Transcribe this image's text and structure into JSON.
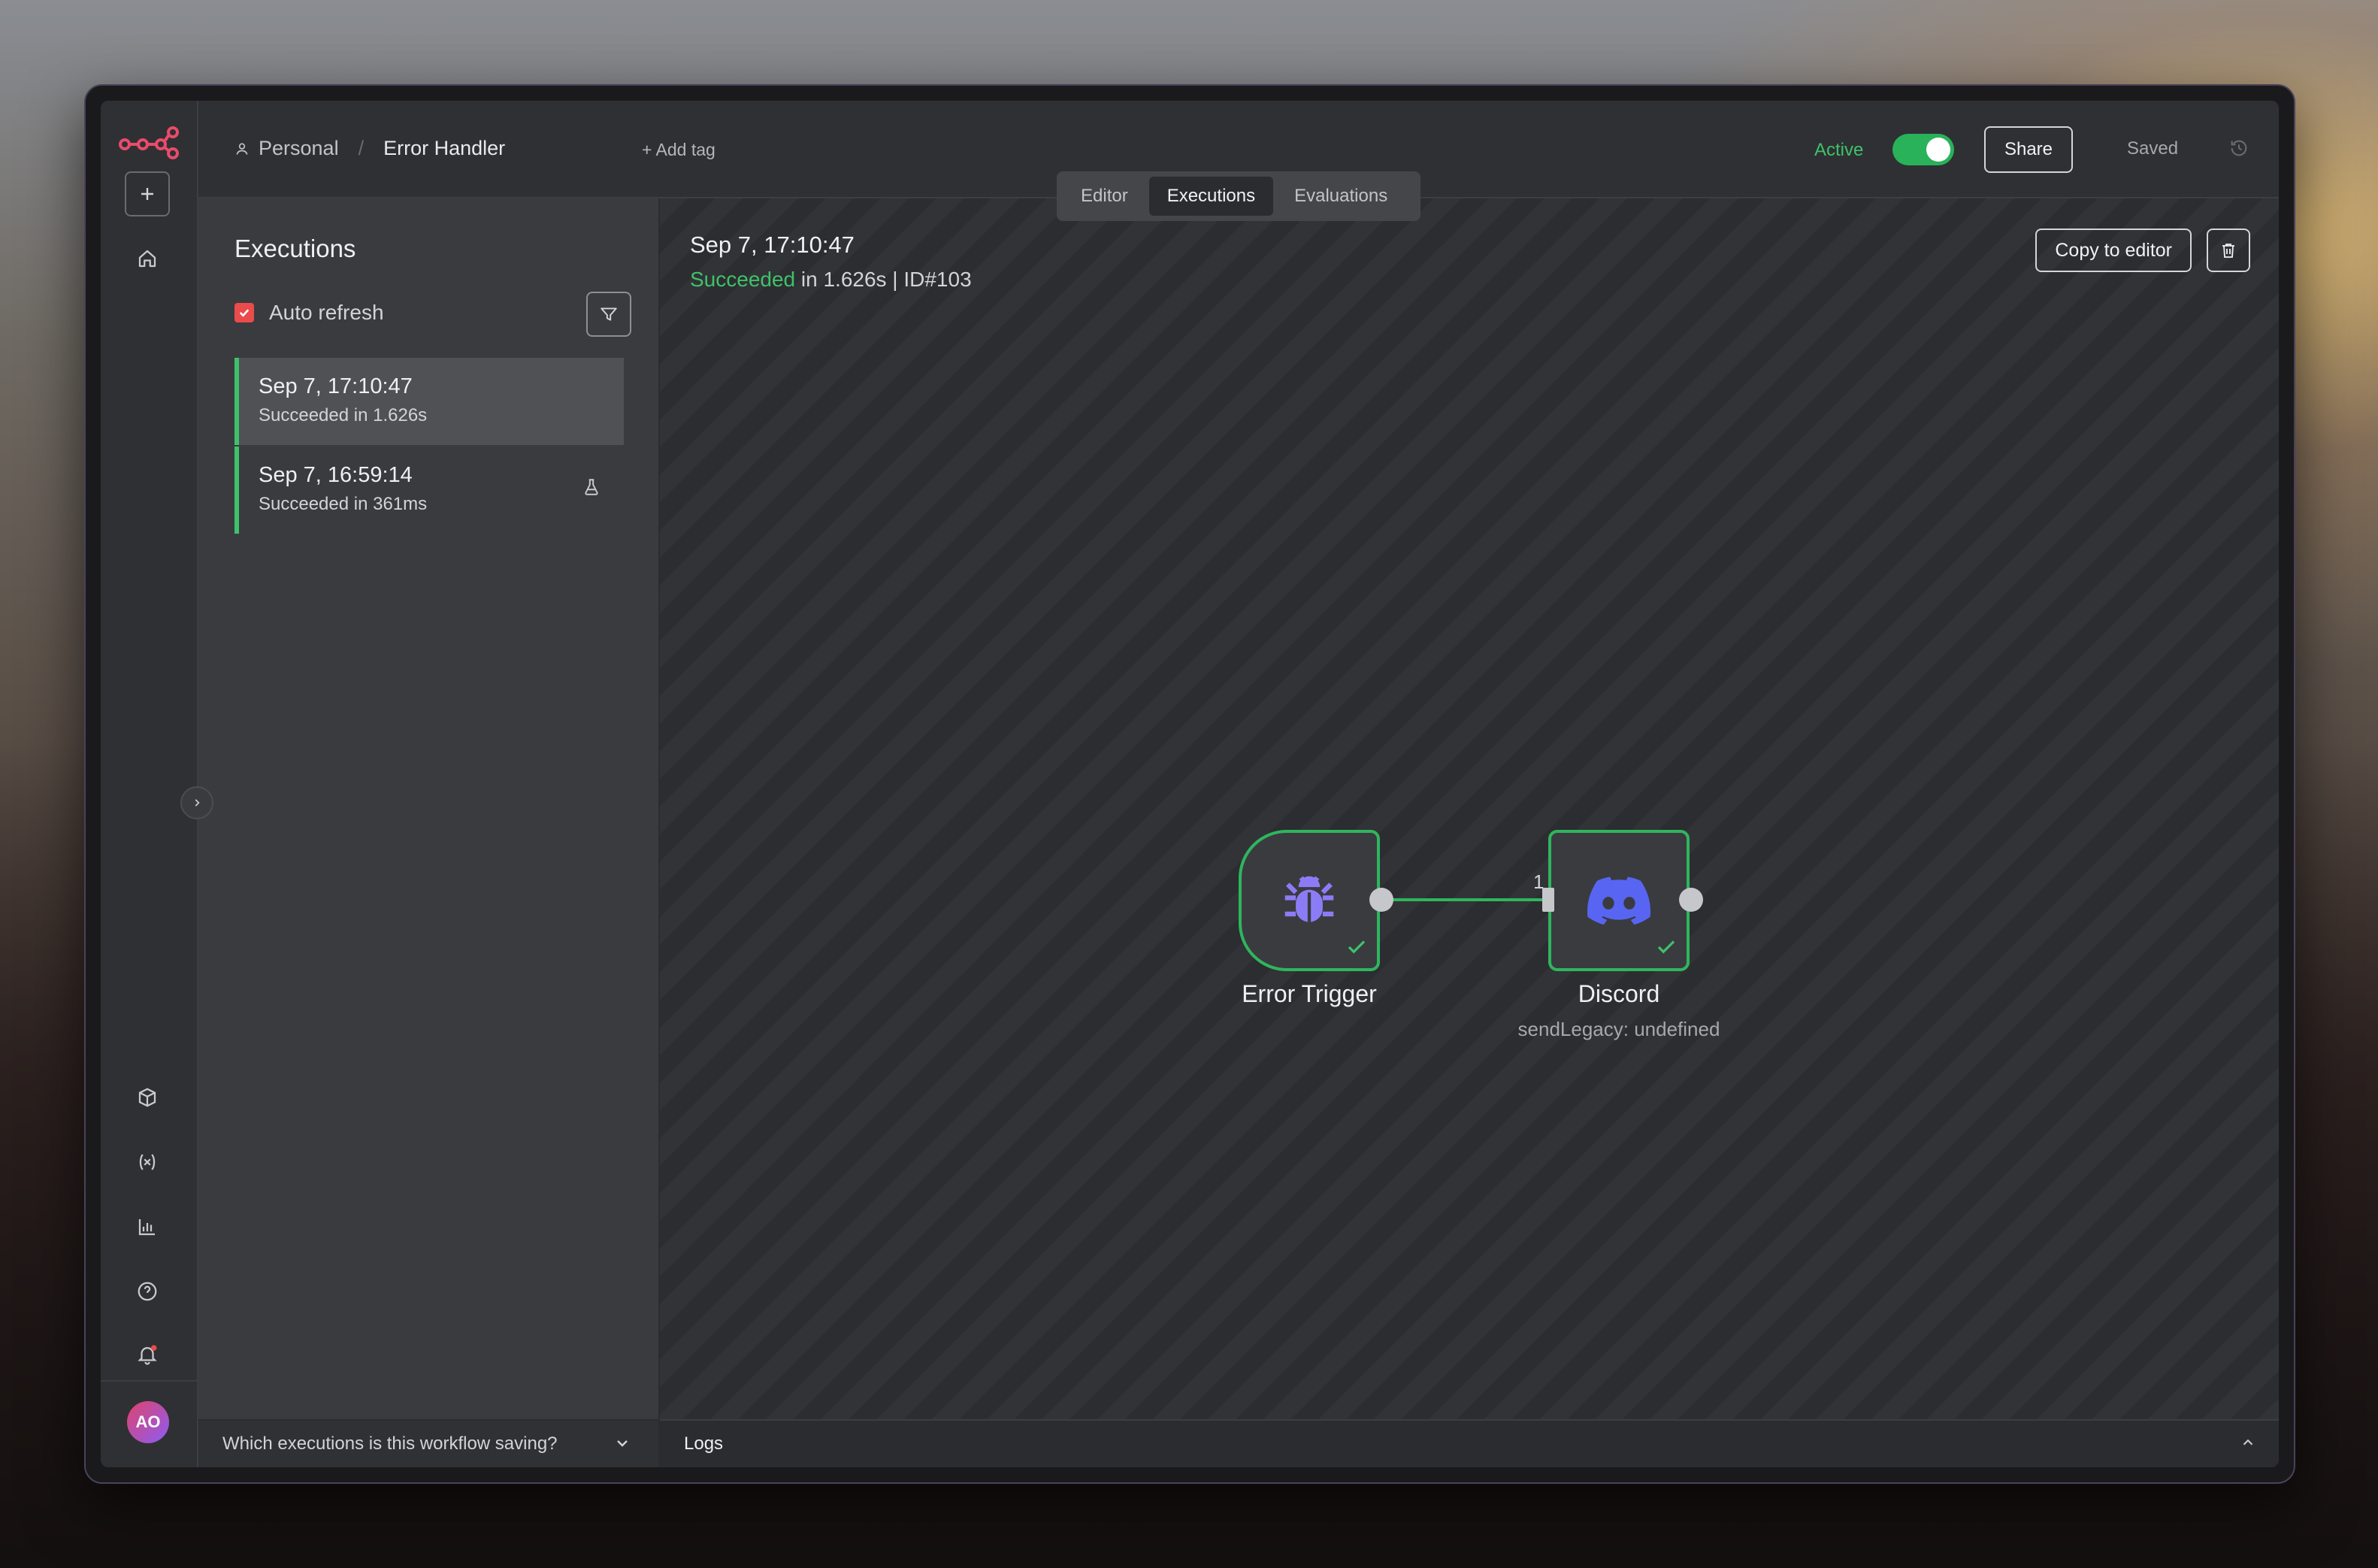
{
  "workspace": {
    "project": "Personal",
    "workflow_name": "Error Handler",
    "add_tag_label": "+ Add tag"
  },
  "header": {
    "active_label": "Active",
    "active": true,
    "share_label": "Share",
    "saved_label": "Saved"
  },
  "tabs": [
    {
      "label": "Editor",
      "active": false
    },
    {
      "label": "Executions",
      "active": true
    },
    {
      "label": "Evaluations",
      "active": false
    }
  ],
  "executions_panel": {
    "title": "Executions",
    "auto_refresh_label": "Auto refresh",
    "auto_refresh_checked": true,
    "items": [
      {
        "date": "Sep 7, 17:10:47",
        "status": "Succeeded in 1.626s",
        "selected": true
      },
      {
        "date": "Sep 7, 16:59:14",
        "status": "Succeeded in 361ms",
        "selected": false
      }
    ],
    "saving_question": "Which executions is this workflow saving?"
  },
  "execution_detail": {
    "date": "Sep 7, 17:10:47",
    "status_word": "Succeeded",
    "status_rest": " in 1.626s | ID#103",
    "copy_to_editor_label": "Copy to editor"
  },
  "workflow": {
    "nodes": [
      {
        "name": "Error Trigger",
        "subtitle": "",
        "icon": "bug-icon"
      },
      {
        "name": "Discord",
        "subtitle": "sendLegacy: undefined",
        "icon": "discord-icon"
      }
    ],
    "edge_label": "1 item"
  },
  "logs_label": "Logs",
  "user": {
    "initials": "AO"
  },
  "colors": {
    "accent_red": "#ea4b4b",
    "success_green": "#3ec26a",
    "discord_blurple": "#5865F2",
    "bug_purple": "#8b7cf6"
  }
}
